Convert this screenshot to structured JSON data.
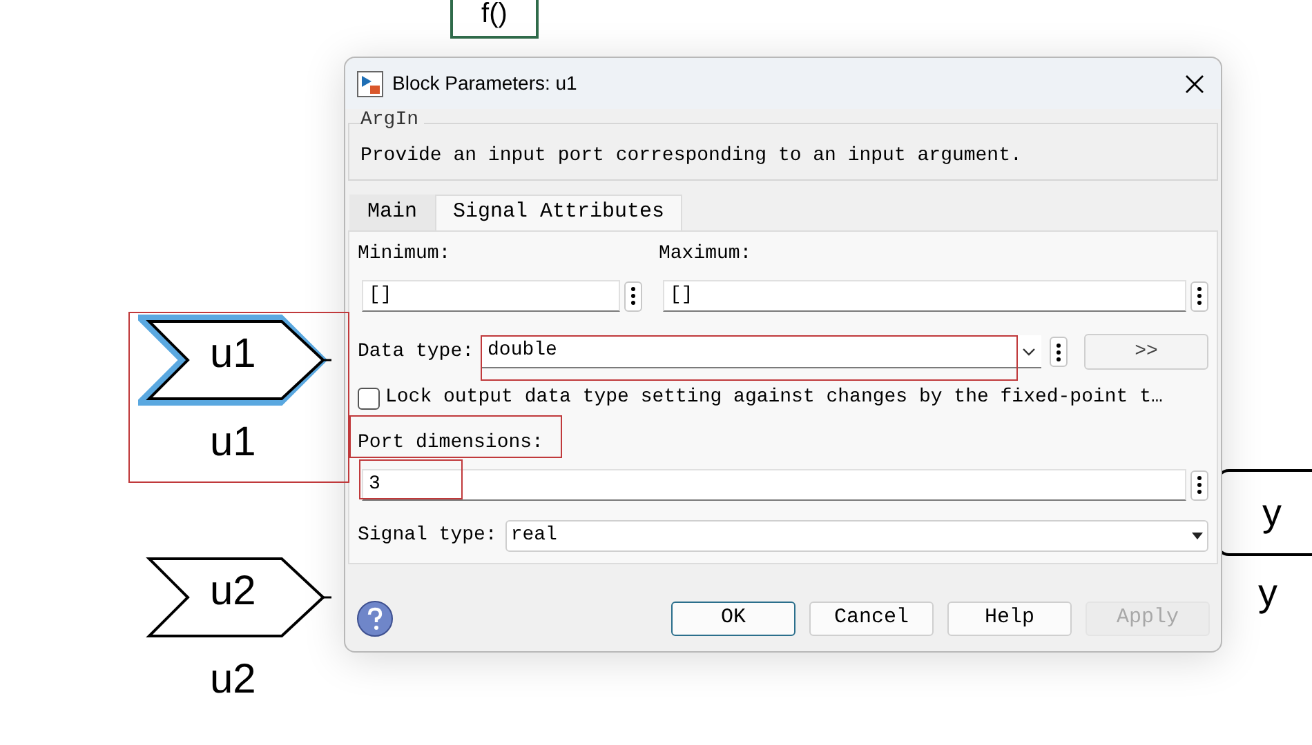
{
  "canvas": {
    "inports": [
      {
        "symbol": "u1",
        "name": "u1",
        "selected": true
      },
      {
        "symbol": "u2",
        "name": "u2",
        "selected": false
      }
    ],
    "outport": {
      "symbol": "y",
      "name": "y"
    },
    "top_block": {
      "symbol": "f()"
    }
  },
  "dialog": {
    "title": "Block Parameters: u1",
    "group": "ArgIn",
    "description": "Provide an input port corresponding to an input argument.",
    "tabs": [
      {
        "label": "Main",
        "selected": false
      },
      {
        "label": "Signal Attributes",
        "selected": true
      }
    ],
    "minimum": {
      "label": "Minimum:",
      "value": "[]"
    },
    "maximum": {
      "label": "Maximum:",
      "value": "[]"
    },
    "data_type": {
      "label": "Data type:",
      "value": "double",
      "assistant": ">>"
    },
    "lock": {
      "label": "Lock output data type setting against changes by the fixed-point t…",
      "checked": false
    },
    "port_dimensions": {
      "label": "Port dimensions:",
      "value": "3"
    },
    "signal_type": {
      "label": "Signal type:",
      "value": "real"
    },
    "buttons": [
      {
        "label": "OK",
        "disabled": false,
        "default": true
      },
      {
        "label": "Cancel",
        "disabled": false,
        "default": false
      },
      {
        "label": "Help",
        "disabled": false,
        "default": false
      },
      {
        "label": "Apply",
        "disabled": true,
        "default": false
      }
    ]
  }
}
